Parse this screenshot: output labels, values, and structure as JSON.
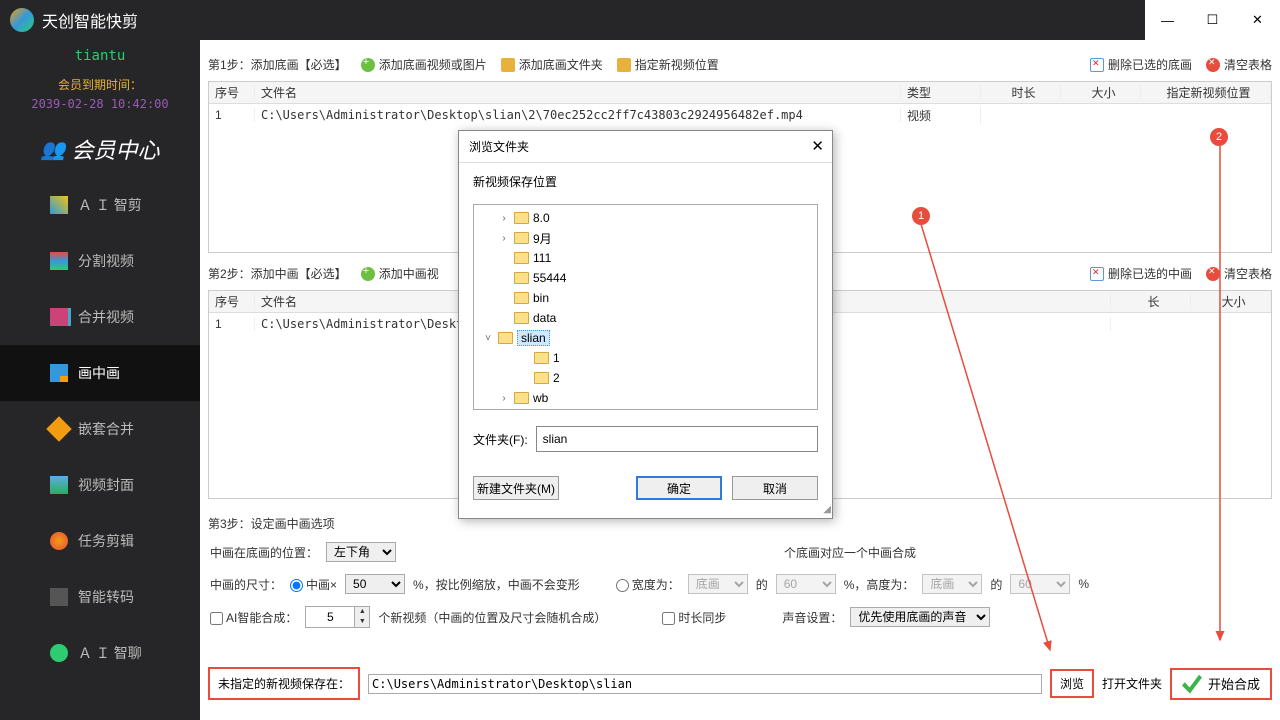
{
  "app": {
    "title": "天创智能快剪"
  },
  "window": {
    "min": "—",
    "max": "☐",
    "close": "✕"
  },
  "sidebar": {
    "user": "tiantu",
    "expire_label": "会员到期时间：",
    "expire_date": "2039-02-28 10:42:00",
    "member_center": "会员中心",
    "items": [
      "Ａ Ｉ 智剪",
      "分割视频",
      "合并视频",
      "画中画",
      "嵌套合并",
      "视频封面",
      "任务剪辑",
      "智能转码",
      "Ａ Ｉ 智聊"
    ]
  },
  "toolbar1": {
    "step": "第1步：添加底画【必选】",
    "add_video": "添加底画视频或图片",
    "add_folder": "添加底画文件夹",
    "set_pos": "指定新视频位置",
    "del_sel": "删除已选的底画",
    "clear": "清空表格"
  },
  "table1": {
    "headers": [
      "序号",
      "文件名",
      "类型",
      "时长",
      "大小",
      "指定新视频位置"
    ],
    "rows": [
      {
        "idx": "1",
        "name": "C:\\Users\\Administrator\\Desktop\\slian\\2\\70ec252cc2ff7c43803c2924956482ef.mp4",
        "type": "视频",
        "dur": "",
        "size": "",
        "pos": ""
      }
    ]
  },
  "toolbar2": {
    "step": "第2步：添加中画【必选】",
    "add_video": "添加中画视",
    "del_sel": "删除已选的中画",
    "clear": "清空表格"
  },
  "table2": {
    "headers": [
      "序号",
      "文件名",
      "长",
      "大小"
    ],
    "rows": [
      {
        "idx": "1",
        "name": "C:\\Users\\Administrator\\Desktop\\",
        "dur": "",
        "size": ""
      }
    ]
  },
  "step3": {
    "label": "第3步：设定画中画选项",
    "pos_label": "中画在底画的位置：",
    "pos_value": "左下角",
    "map_note": "个底画对应一个中画合成",
    "size_label": "中画的尺寸：",
    "r1": "中画×",
    "pct1": "50",
    "pct_suffix": "%，按比例缩放，中画不会变形",
    "r2": "宽度为：",
    "base_sel": "底画",
    "of": "的",
    "pct2": "60",
    "h_label": "%，高度为：",
    "pct3": "60",
    "tail": "%",
    "ai_label": "AI智能合成：",
    "ai_num": "5",
    "ai_tail": "个新视频（中画的位置及尺寸会随机合成）",
    "sync_label": "时长同步",
    "sound_label": "声音设置：",
    "sound_value": "优先使用底画的声音"
  },
  "bottom": {
    "save_label": "未指定的新视频保存在：",
    "save_path": "C:\\Users\\Administrator\\Desktop\\slian",
    "browse": "浏览",
    "open_folder": "打开文件夹",
    "start": "开始合成"
  },
  "dialog": {
    "title": "浏览文件夹",
    "subtitle": "新视频保存位置",
    "tree": [
      {
        "exp": "›",
        "indent": 1,
        "label": "8.0"
      },
      {
        "exp": "›",
        "indent": 1,
        "label": "9月"
      },
      {
        "exp": "",
        "indent": 1,
        "label": "111"
      },
      {
        "exp": "",
        "indent": 1,
        "label": "55444"
      },
      {
        "exp": "",
        "indent": 1,
        "label": "bin"
      },
      {
        "exp": "",
        "indent": 1,
        "label": "data"
      },
      {
        "exp": "˅",
        "indent": 0,
        "label": "slian",
        "sel": true
      },
      {
        "exp": "",
        "indent": 2,
        "label": "1"
      },
      {
        "exp": "",
        "indent": 2,
        "label": "2"
      },
      {
        "exp": "›",
        "indent": 1,
        "label": "wb"
      }
    ],
    "folder_label": "文件夹(F):",
    "folder_value": "slian",
    "new_folder": "新建文件夹(M)",
    "ok": "确定",
    "cancel": "取消"
  },
  "annot": {
    "b1": "1",
    "b2": "2"
  }
}
